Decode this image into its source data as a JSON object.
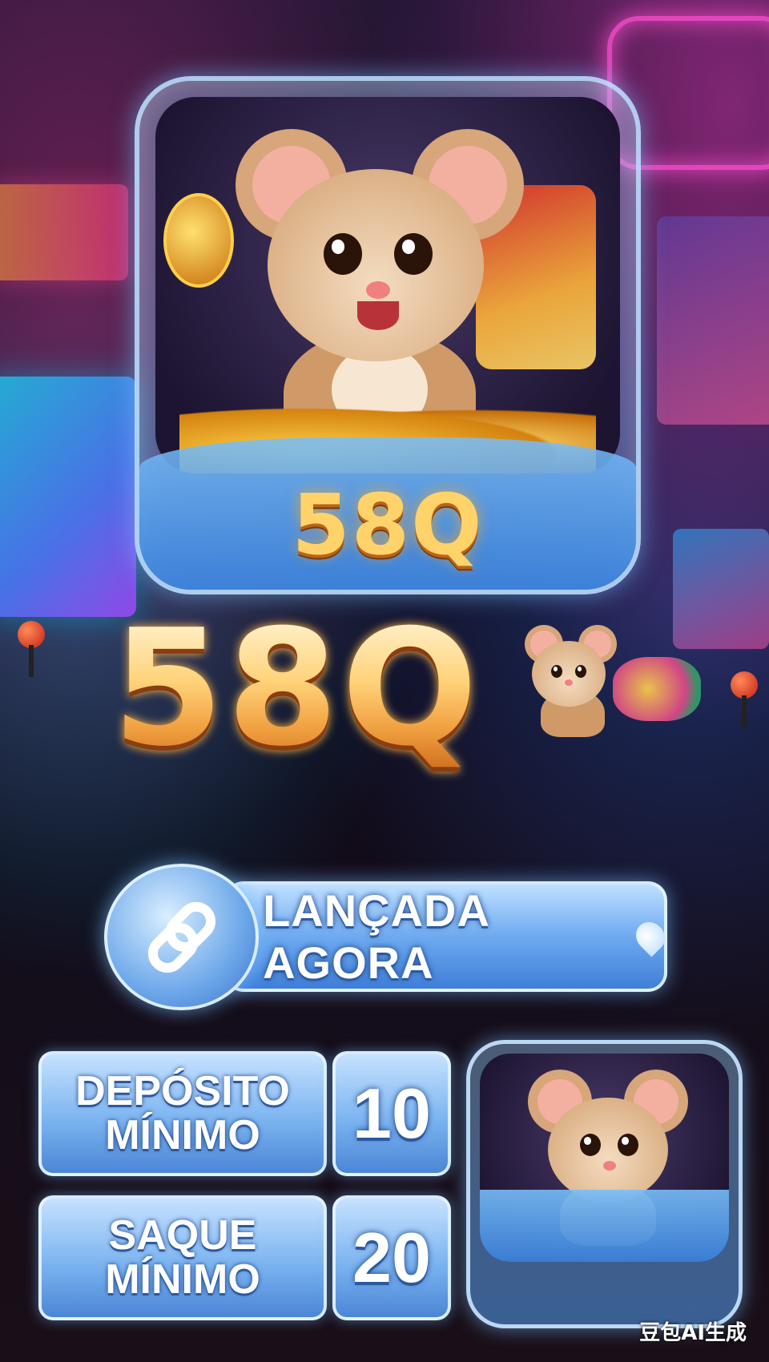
{
  "brand": {
    "name": "58Q"
  },
  "banner": {
    "launch_label": "LANÇADA AGORA",
    "icon": "link-icon",
    "decor_icon": "water-drop-icon"
  },
  "stats": {
    "deposit": {
      "label_line1": "DEPÓSITO",
      "label_line2": "MÍNIMO",
      "value": "10"
    },
    "withdraw": {
      "label_line1": "SAQUE",
      "label_line2": "MÍNIMO",
      "value": "20"
    }
  },
  "watermark": "豆包AI生成",
  "colors": {
    "gold": "#ffd36a",
    "ice_blue": "#7cb4f0",
    "neon_pink": "#ff4fd0"
  }
}
